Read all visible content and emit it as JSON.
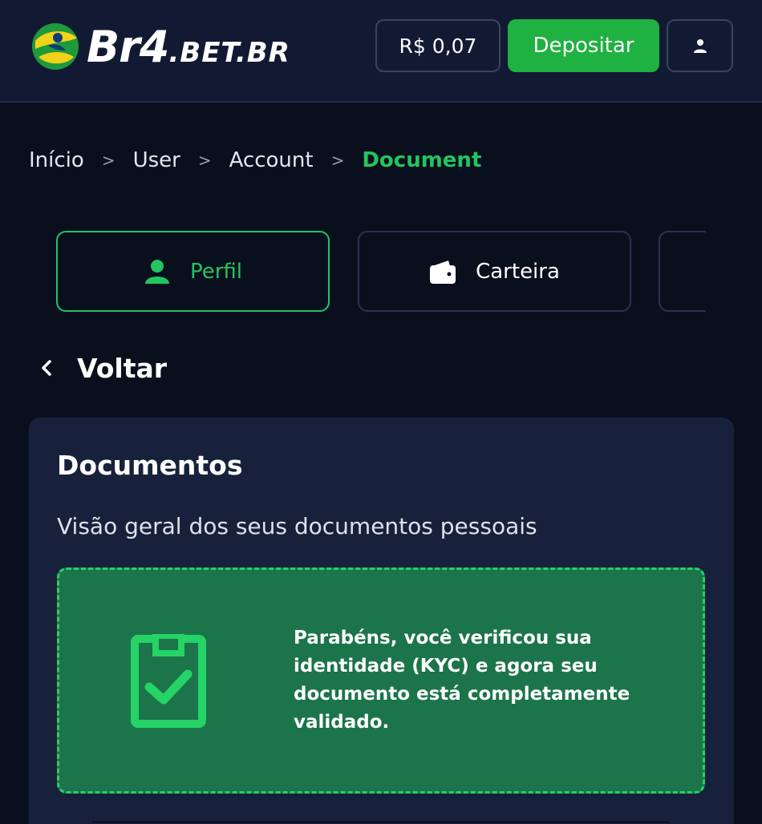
{
  "header": {
    "logo": {
      "text_main": "Br4",
      "text_domain": ".BET.BR"
    },
    "balance": "R$ 0,07",
    "deposit_label": "Depositar",
    "user_icon": "user-icon"
  },
  "breadcrumb": {
    "items": [
      "Início",
      "User",
      "Account"
    ],
    "separator": ">",
    "current": "Document"
  },
  "tabs": [
    {
      "label": "Perfil",
      "icon": "user-icon",
      "active": true
    },
    {
      "label": "Carteira",
      "icon": "wallet-icon",
      "active": false
    }
  ],
  "back": {
    "label": "Voltar",
    "icon": "chevron-left-icon"
  },
  "documents": {
    "title": "Documentos",
    "subtitle": "Visão geral dos seus documentos pessoais",
    "kyc_message": "Parabéns, você verificou sua identidade (KYC) e agora seu documento está completamente validado.",
    "kyc_icon": "clipboard-check-icon"
  },
  "colors": {
    "background": "#0a0f1e",
    "header": "#121a33",
    "accent": "#22c55e",
    "deposit": "#1fb141",
    "card": "#18213c",
    "kyc_box": "#1c744a"
  }
}
